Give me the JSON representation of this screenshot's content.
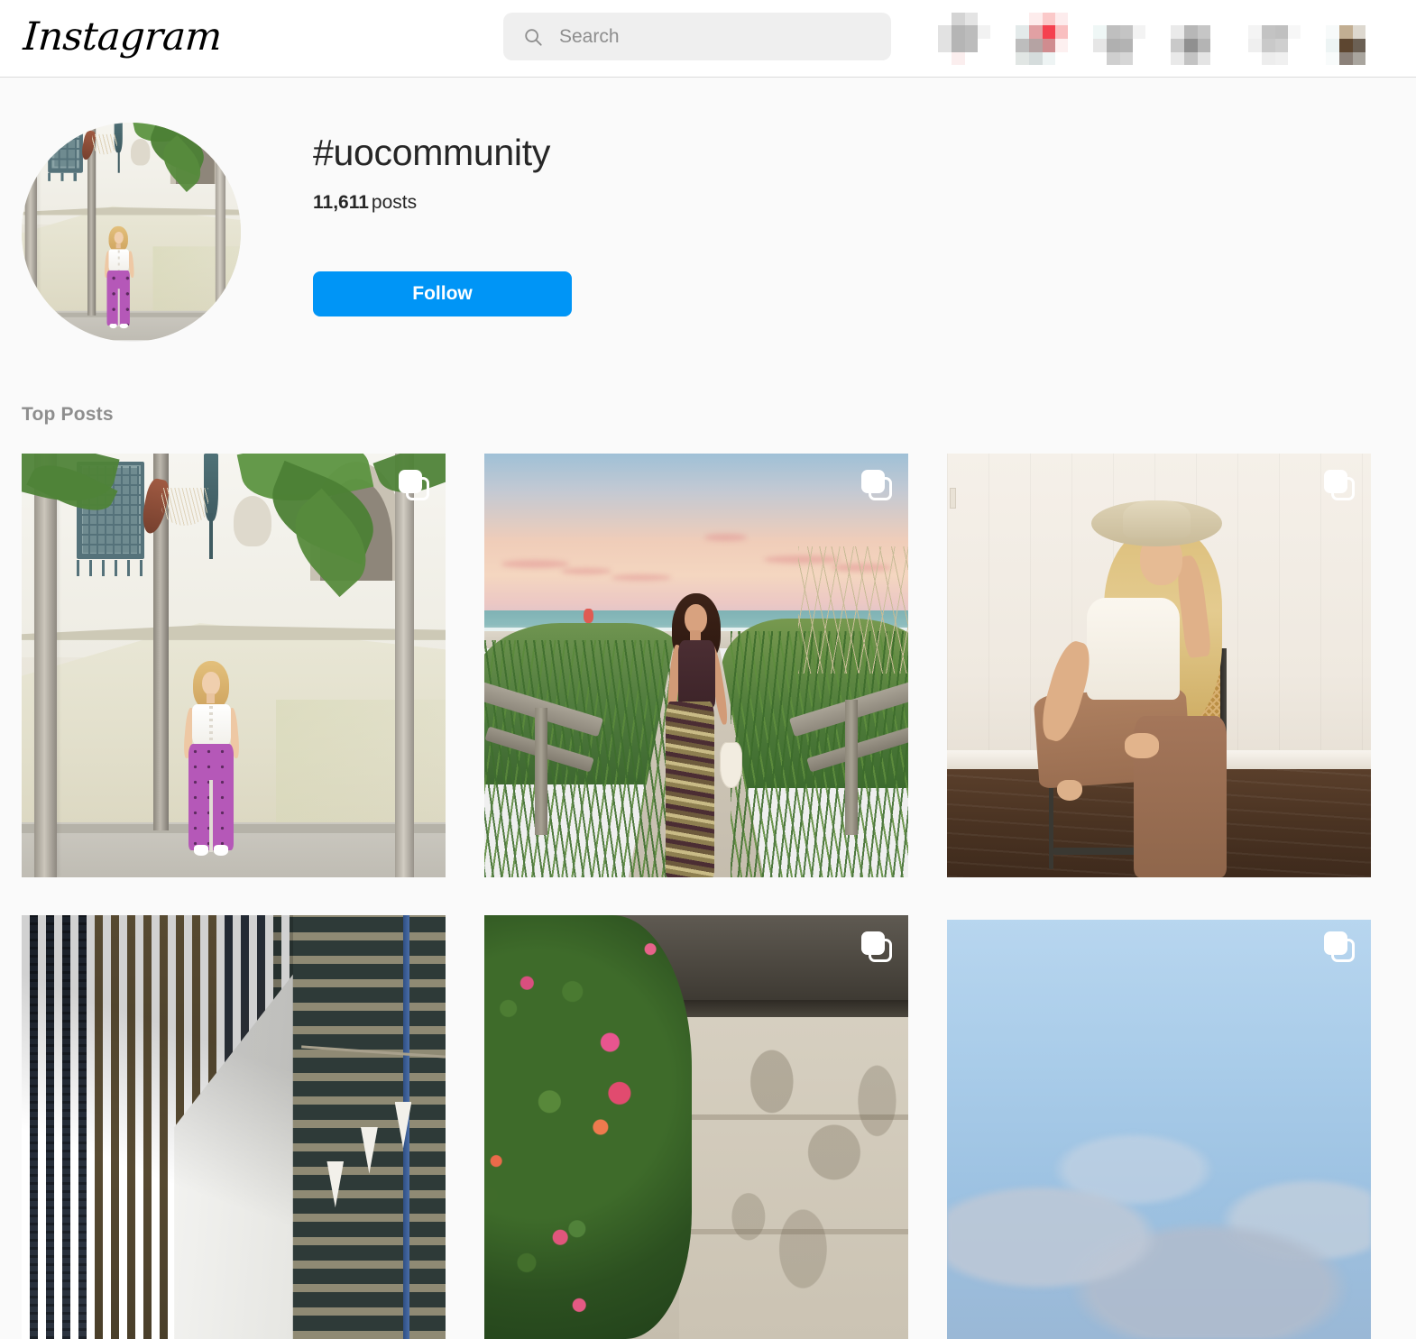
{
  "header": {
    "logo_text": "Instagram",
    "search": {
      "placeholder": "Search",
      "value": "",
      "icon": "search-icon"
    },
    "nav_icons": [
      {
        "name": "home-icon",
        "state": "pixelated"
      },
      {
        "name": "messenger-icon",
        "state": "pixelated"
      },
      {
        "name": "new-post-icon",
        "state": "pixelated"
      },
      {
        "name": "explore-icon",
        "state": "pixelated"
      },
      {
        "name": "activity-heart-icon",
        "state": "pixelated"
      },
      {
        "name": "profile-avatar-icon",
        "state": "pixelated"
      }
    ]
  },
  "hashtag": {
    "title": "#uocommunity",
    "post_count": "11,611",
    "post_count_label": "posts",
    "follow_label": "Follow",
    "avatar_alt": "Woman in white top and purple pants by stucco wall with palm trees"
  },
  "section": {
    "top_posts_label": "Top Posts"
  },
  "colors": {
    "accent_blue": "#0095f6",
    "page_background": "#fafafa",
    "header_background": "#ffffff",
    "border": "#dbdbdb",
    "search_background": "#efefef",
    "muted_text": "#8e8e8e",
    "primary_text": "#262626"
  },
  "posts": [
    {
      "id": "post-1",
      "scene": "s1",
      "alt": "Blonde woman in white corset top and purple patterned pants standing by cream stucco wall with palm trees",
      "carousel": true
    },
    {
      "id": "post-2",
      "scene": "s2",
      "alt": "Woman in brown tank top and wavy-print maxi skirt on sandy beach path at pastel sunset with wooden rails",
      "carousel": true
    },
    {
      "id": "post-3",
      "scene": "s3",
      "alt": "Blonde woman in wide-brim hat, white tank and brown pants sitting on cane-back chair by white panel wall",
      "carousel": true
    },
    {
      "id": "post-4",
      "scene": "s4",
      "alt": "White vertical architectural fins in front of dark city buildings with bunting flags",
      "carousel": false
    },
    {
      "id": "post-5",
      "scene": "s5",
      "alt": "Pink and orange bougainvillea blossoms against beige garage door with dappled shadows",
      "carousel": true
    },
    {
      "id": "post-6",
      "scene": "s6",
      "alt": "Blue sky with soft grey clouds",
      "carousel": true
    }
  ]
}
